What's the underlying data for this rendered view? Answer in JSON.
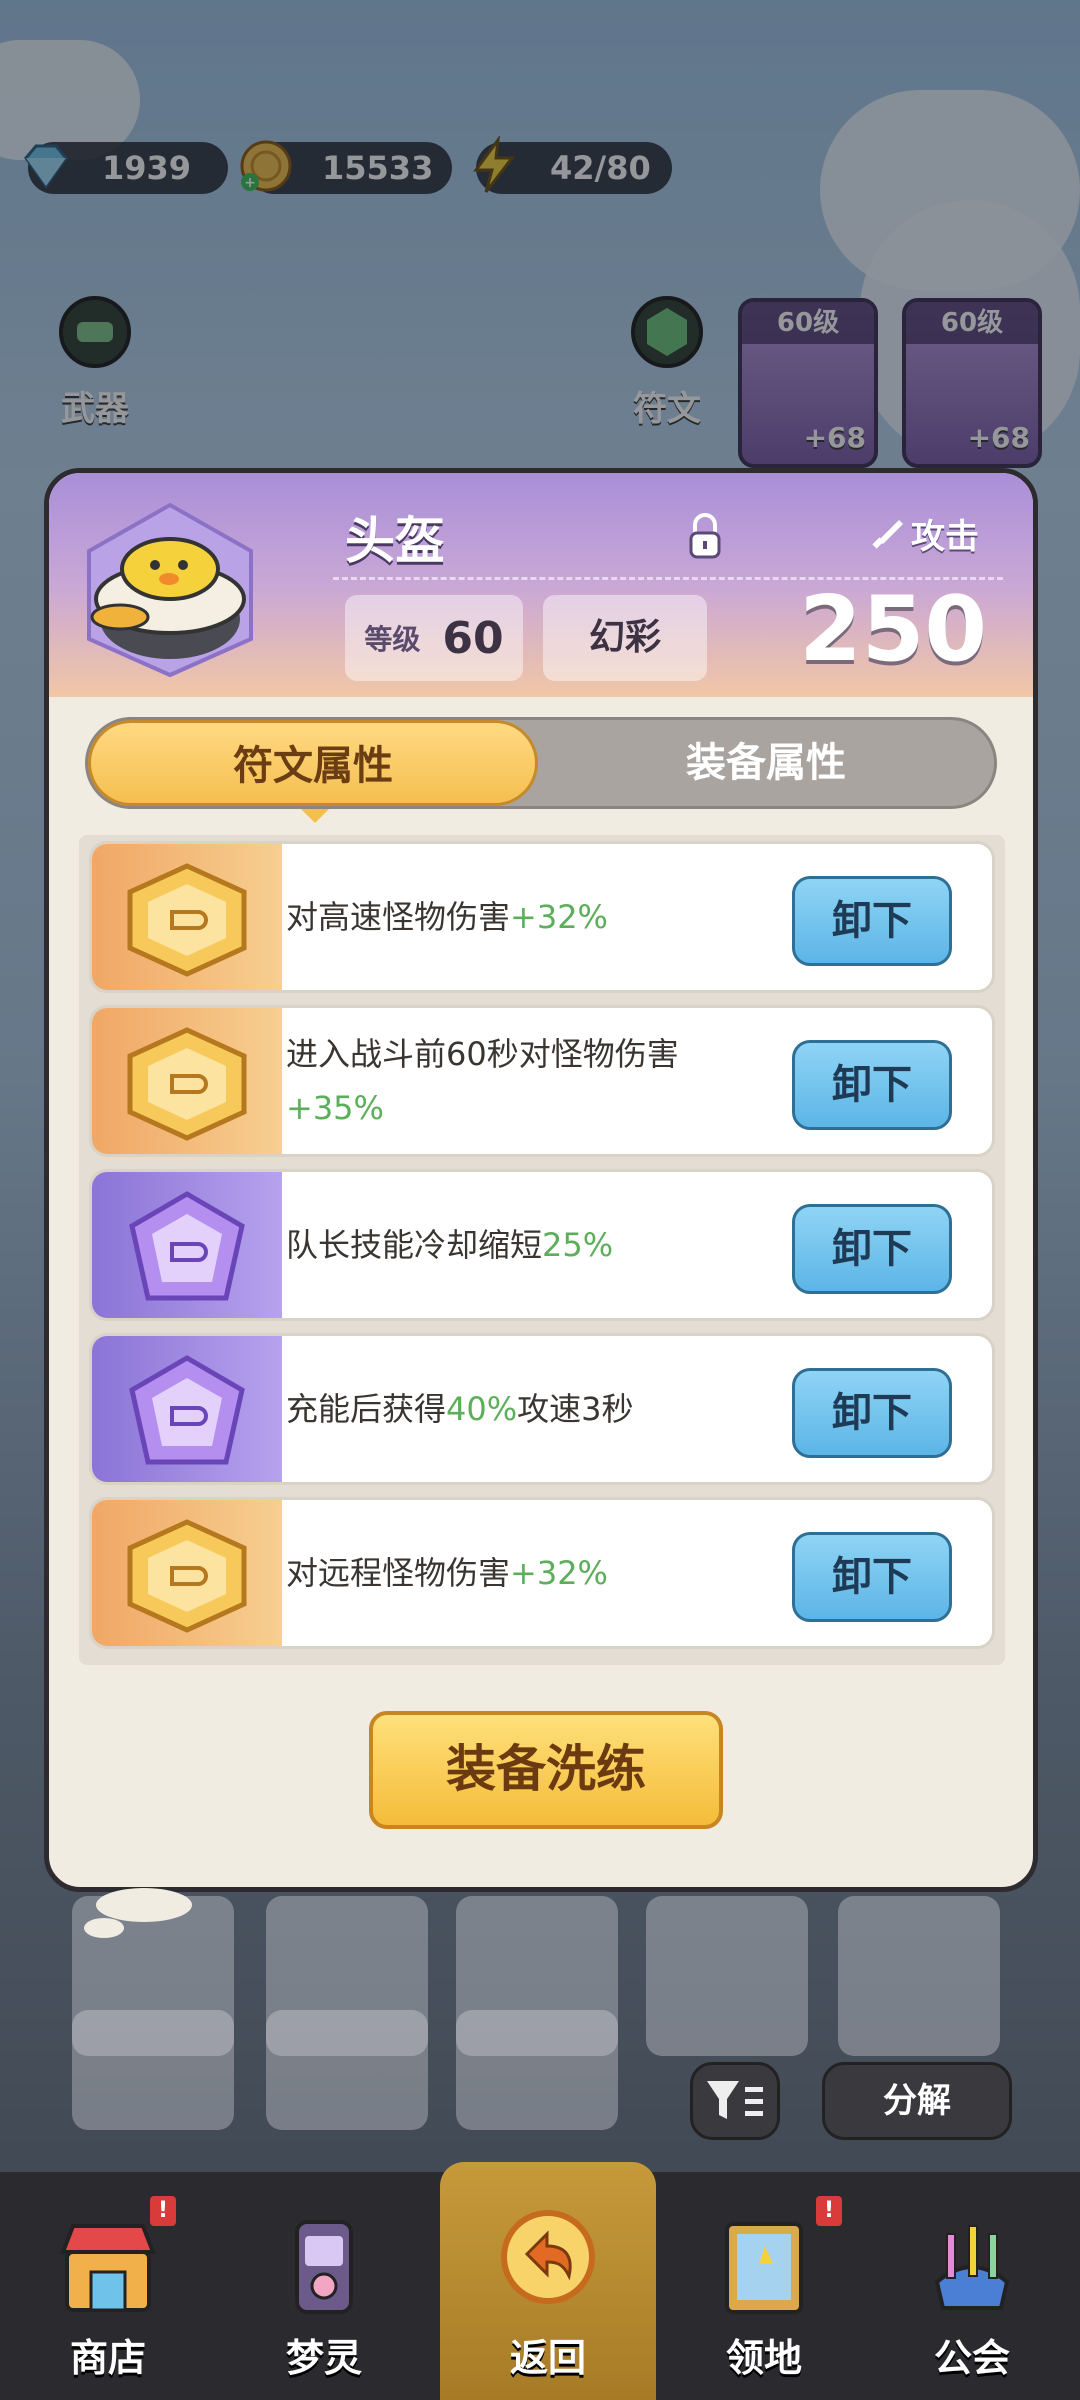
{
  "resources": {
    "diamonds": "1939",
    "coins": "15533",
    "energy": "42/80"
  },
  "top": {
    "weapon_label": "武器",
    "rune_label": "符文",
    "equip_cards": [
      {
        "level": "60级",
        "plus": "+68"
      },
      {
        "level": "60级",
        "plus": "+68"
      }
    ]
  },
  "modal": {
    "title": "头盔",
    "attack_label": "攻击",
    "level_key": "等级",
    "level_value": "60",
    "rarity": "幻彩",
    "power": "250",
    "tabs": {
      "rune_attrs": "符文属性",
      "equip_attrs": "装备属性"
    },
    "runes": [
      {
        "text": "对高速怪物伤害",
        "value": "+32%",
        "color": "gold",
        "button": "卸下"
      },
      {
        "text": "进入战斗前60秒对怪物伤害",
        "value": "+35%",
        "color": "gold",
        "button": "卸下"
      },
      {
        "text": "队长技能冷却缩短",
        "value": "25%",
        "color": "purple",
        "button": "卸下"
      },
      {
        "text": "充能后获得",
        "value": "40%",
        "suffix": "攻速3秒",
        "color": "purple",
        "button": "卸下"
      },
      {
        "text": "对远程怪物伤害",
        "value": "+32%",
        "color": "gold",
        "button": "卸下"
      }
    ],
    "refine_button": "装备洗练"
  },
  "actions": {
    "split": "分解"
  },
  "nav": [
    {
      "label": "商店",
      "badge": "!"
    },
    {
      "label": "梦灵"
    },
    {
      "label": "返回"
    },
    {
      "label": "领地",
      "badge": "!"
    },
    {
      "label": "公会"
    }
  ],
  "colors": {
    "accent_green": "#5dae5a",
    "unload_blue": "#5cb5e6",
    "tab_gold": "#f5bf4f"
  }
}
